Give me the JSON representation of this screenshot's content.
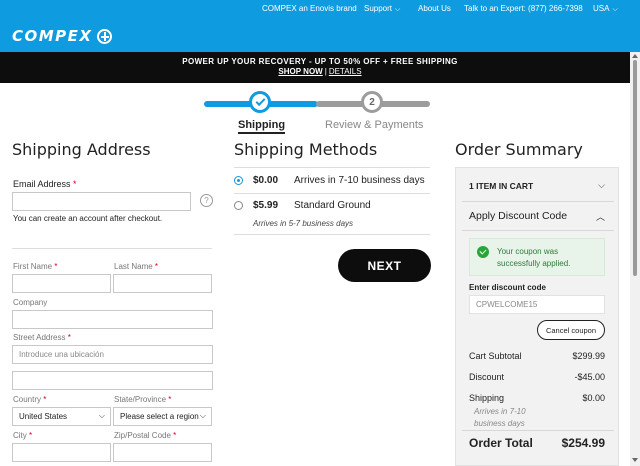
{
  "header": {
    "utility_nav": {
      "brand": "COMPEX an Enovis brand",
      "support": "Support",
      "about": "About Us",
      "expert": "Talk to an Expert: (877) 266-7398",
      "region": "USA"
    },
    "logo": "COMPEX"
  },
  "promo": {
    "headline": "POWER UP YOUR RECOVERY - UP TO 50% OFF + FREE SHIPPING",
    "shop_now": "SHOP NOW",
    "separator": "|",
    "details": "DETAILS"
  },
  "progress": {
    "step1": "Shipping",
    "step2_number": "2",
    "step2": "Review & Payments"
  },
  "shipping_address": {
    "title": "Shipping Address",
    "email_label": "Email Address",
    "required_mark": "*",
    "help_icon": "?",
    "account_note": "You can create an account after checkout.",
    "first_name_label": "First Name",
    "last_name_label": "Last Name",
    "company_label": "Company",
    "street_label": "Street Address",
    "street_placeholder": "Introduce una ubicación",
    "country_label": "Country",
    "country_value": "United States",
    "state_label": "State/Province",
    "state_value": "Please select a region",
    "city_label": "City",
    "zip_label": "Zip/Postal Code"
  },
  "shipping_methods": {
    "title": "Shipping Methods",
    "options": [
      {
        "price": "$0.00",
        "name": "Arrives in 7-10 business days",
        "selected": true
      },
      {
        "price": "$5.99",
        "name": "Standard Ground",
        "sub": "Arrives in 5-7 business days",
        "selected": false
      }
    ],
    "next_label": "NEXT"
  },
  "order_summary": {
    "title": "Order Summary",
    "items_in_cart": "1 ITEM IN CART",
    "discount_header": "Apply Discount Code",
    "success_message": "Your coupon was successfully applied.",
    "code_label": "Enter discount code",
    "code_value": "CPWELCOME15",
    "cancel_label": "Cancel coupon",
    "subtotal_label": "Cart Subtotal",
    "subtotal_value": "$299.99",
    "discount_label": "Discount",
    "discount_value": "-$45.00",
    "shipping_label": "Shipping",
    "shipping_value": "$0.00",
    "shipping_sub": "Arrives in 7-10 business days",
    "total_label": "Order Total",
    "total_value": "$254.99"
  },
  "colors": {
    "brand_blue": "#0f9be0",
    "promo_black": "#0d0d0d",
    "required_red": "#d0021b",
    "success_green": "#27a53a"
  }
}
